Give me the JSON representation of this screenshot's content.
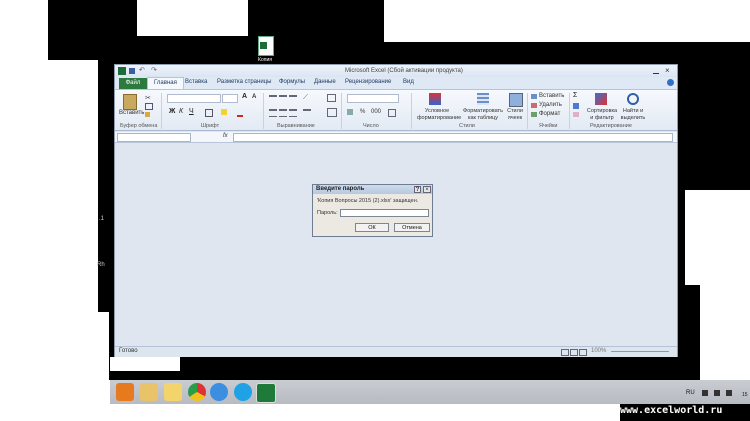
{
  "desktop": {
    "file_icon_label": "Копия",
    "edge_text_1": ".1",
    "edge_text_2": "Rh"
  },
  "excel": {
    "title": "Microsoft Excel (Сбой активации продукта)",
    "tabs": [
      "Файл",
      "Главная",
      "Вставка",
      "Разметка страницы",
      "Формулы",
      "Данные",
      "Рецензирование",
      "Вид"
    ],
    "ribbon": {
      "paste_label": "Вставить",
      "clipboard_group": "Буфер обмена",
      "font_group": "Шрифт",
      "align_group": "Выравнивание",
      "number_group": "Число",
      "styles_group": "Стили",
      "cells_group": "Ячейки",
      "edit_group": "Редактирование",
      "cond_format": "Условное форматирование",
      "format_table": "Форматировать как таблицу",
      "cell_styles": "Стили ячеек",
      "insert": "Вставить",
      "delete": "Удалить",
      "format": "Формат",
      "sort_filter": "Сортировка и фильтр",
      "find_select": "Найти и выделить",
      "bold": "Ж",
      "italic": "К",
      "underline": "Ч",
      "font_size_up": "A",
      "font_size_down": "A",
      "percent": "%",
      "thousands": "000",
      "sigma": "Σ"
    },
    "formula_bar": {
      "fx": "fx"
    },
    "status": {
      "ready": "Готово",
      "zoom": "100%"
    }
  },
  "dialog": {
    "title": "Введите пароль",
    "message": "'Копия Вопросы 2015 (2).xlsx' защищен.",
    "password_label": "Пароль:",
    "password_value": "",
    "ok": "ОК",
    "cancel": "Отмена",
    "help_glyph": "?",
    "close_glyph": "×"
  },
  "taskbar": {
    "lang": "RU",
    "clock": "15"
  },
  "watermark": "www.excelworld.ru"
}
